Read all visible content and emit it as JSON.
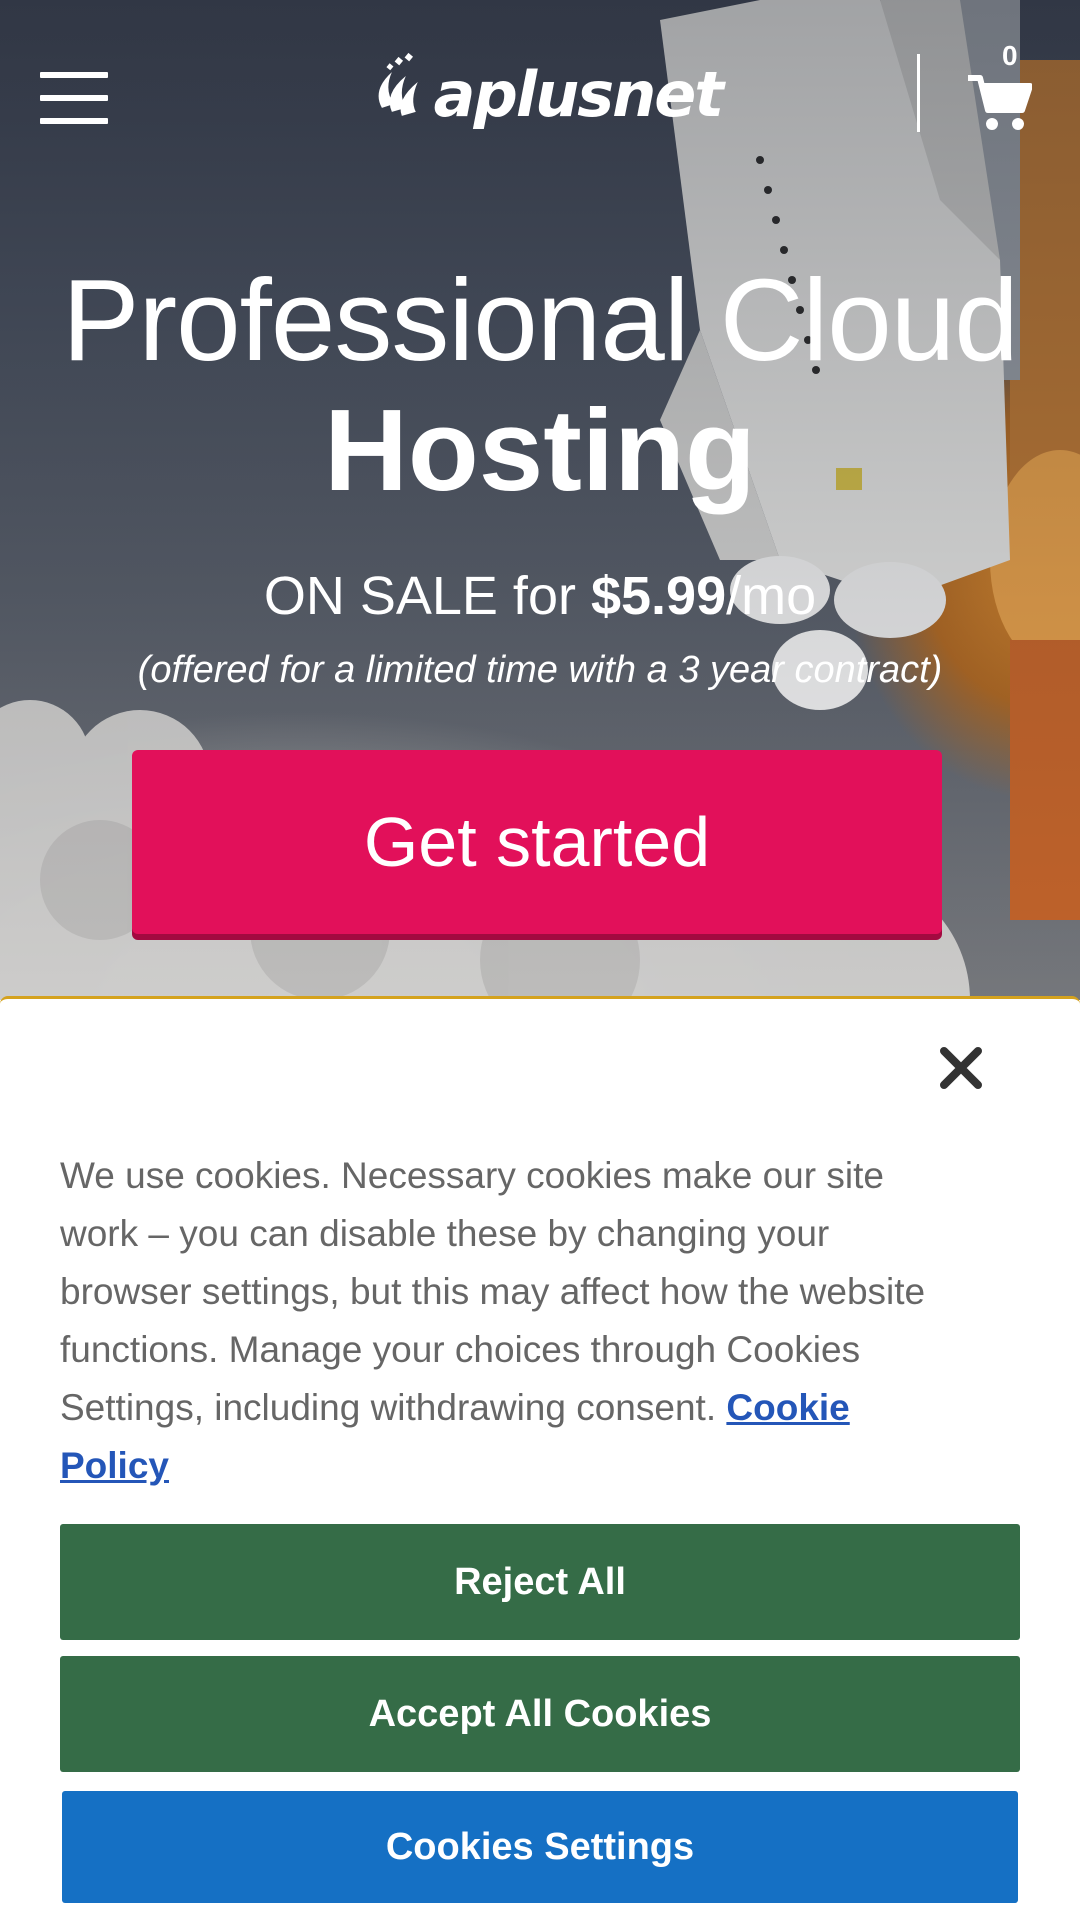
{
  "header": {
    "menu_icon": "hamburger-menu-icon",
    "logo_text": "aplusnet",
    "cart_icon": "shopping-cart-icon",
    "cart_count": "0"
  },
  "hero": {
    "title_line_1": "Professional Cloud",
    "title_line_2": "Hosting",
    "sale_prefix": "ON SALE for ",
    "sale_price": "$5.99",
    "sale_suffix": "/mo",
    "sale_note": "(offered for a limited time with a 3 year contract)",
    "cta_label": "Get started",
    "cta_color": "#e2105a"
  },
  "cookie_banner": {
    "close_icon": "close-icon",
    "message": "We use cookies. Necessary cookies make our site work – you can disable these by changing your browser settings, but this may affect how the website functions. Manage your choices through Cookies Settings, including withdrawing consent. ",
    "link_label": "Cookie Policy",
    "reject_label": "Reject All",
    "accept_label": "Accept All Cookies",
    "settings_label": "Cookies Settings",
    "colors": {
      "reject_bg": "#356c47",
      "accept_bg": "#356c47",
      "settings_bg": "#1570c4",
      "link": "#2456b8",
      "top_border": "#d4a21e"
    }
  }
}
